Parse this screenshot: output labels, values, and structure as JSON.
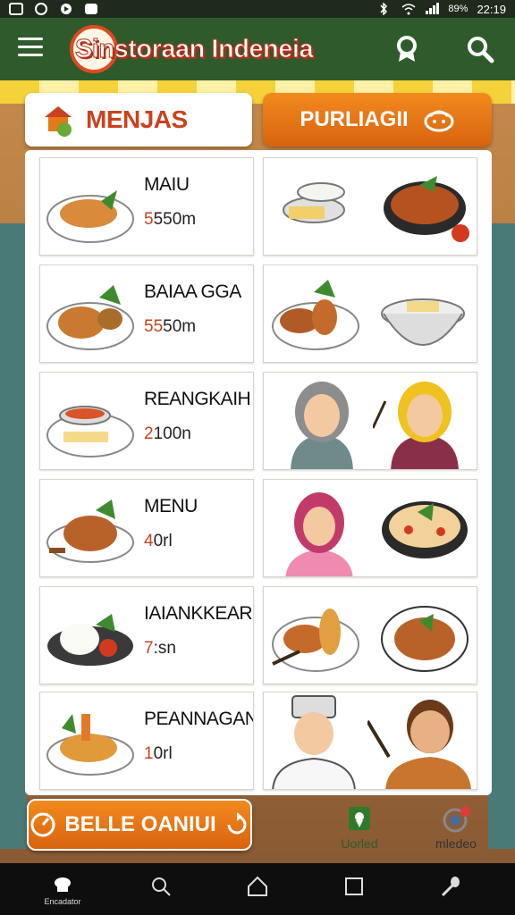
{
  "status_bar": {
    "battery": "89%",
    "time": "22:19"
  },
  "app_bar": {
    "title": "Sinstoraan Indeneia"
  },
  "header": {
    "menu_label": "MENJAS",
    "order_label": "PURLIAGII"
  },
  "menu_items": [
    {
      "name": "MAIU",
      "price": "550m",
      "price_prefix": "5"
    },
    {
      "name": "BAIAA GGA",
      "price": "50m",
      "price_prefix": "55"
    },
    {
      "name": "REANGKAIH",
      "price": "100n",
      "price_prefix": "2"
    },
    {
      "name": "MENU",
      "price": "0rl",
      "price_prefix": "4"
    },
    {
      "name": "IAIANKKEAR",
      "price": ":sn",
      "price_prefix": "7"
    },
    {
      "name": "PEANNAGAN",
      "price": "0rl",
      "price_prefix": "1"
    }
  ],
  "bottom": {
    "book_label": "BELLE OANIUI",
    "tab_location": "Uorled",
    "tab_notify": "mledeo"
  },
  "nav": {
    "home_caption": "Encadator"
  },
  "colors": {
    "primary_green": "#2f5b2c",
    "accent_orange": "#e57817",
    "brand_red": "#c8431d"
  }
}
